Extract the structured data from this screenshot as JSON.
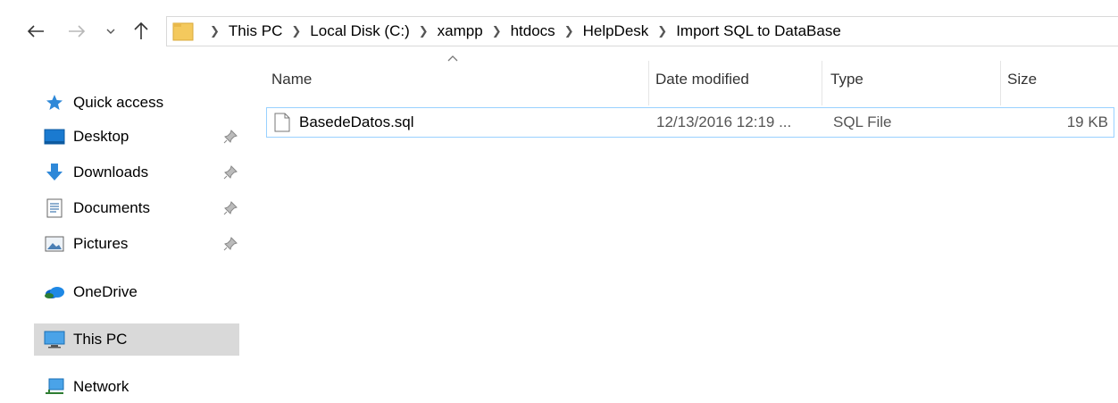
{
  "breadcrumb": [
    "This PC",
    "Local Disk (C:)",
    "xampp",
    "htdocs",
    "HelpDesk",
    "Import SQL to DataBase"
  ],
  "sidebar": {
    "items": [
      {
        "label": "Quick access",
        "icon": "star-icon",
        "pinned": false
      },
      {
        "label": "Desktop",
        "icon": "desktop-icon",
        "pinned": true
      },
      {
        "label": "Downloads",
        "icon": "download-arrow-icon",
        "pinned": true
      },
      {
        "label": "Documents",
        "icon": "document-icon",
        "pinned": true
      },
      {
        "label": "Pictures",
        "icon": "pictures-icon",
        "pinned": true
      },
      {
        "label": "OneDrive",
        "icon": "onedrive-cloud-icon",
        "pinned": false
      },
      {
        "label": "This PC",
        "icon": "monitor-icon",
        "pinned": false,
        "selected": true
      },
      {
        "label": "Network",
        "icon": "network-icon",
        "pinned": false
      }
    ]
  },
  "columns": [
    "Name",
    "Date modified",
    "Type",
    "Size"
  ],
  "files": [
    {
      "name": "BasedeDatos.sql",
      "date_modified": "12/13/2016 12:19 ...",
      "type": "SQL File",
      "size": "19 KB"
    }
  ],
  "colors": {
    "selected_bg": "#d9d9d9",
    "row_border": "#99d1ff",
    "folder": "#f4c95d"
  }
}
